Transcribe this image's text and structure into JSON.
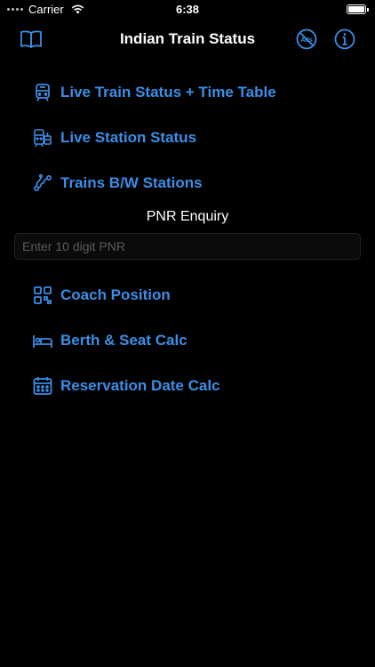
{
  "status_bar": {
    "carrier": "Carrier",
    "time": "6:38"
  },
  "nav": {
    "title": "Indian Train Status",
    "left_icon": "book-icon",
    "right_icons": [
      "no-ads-icon",
      "info-icon"
    ]
  },
  "menu_top": [
    {
      "label": "Live Train Status + Time Table",
      "icon": "train-icon"
    },
    {
      "label": "Live Station Status",
      "icon": "station-icon"
    },
    {
      "label": "Trains B/W Stations",
      "icon": "route-icon"
    }
  ],
  "pnr": {
    "title": "PNR Enquiry",
    "placeholder": "Enter 10 digit PNR",
    "value": ""
  },
  "menu_bottom": [
    {
      "label": "Coach Position",
      "icon": "grid-icon"
    },
    {
      "label": "Berth & Seat Calc",
      "icon": "bed-icon"
    },
    {
      "label": "Reservation Date Calc",
      "icon": "calendar-icon"
    }
  ],
  "colors": {
    "accent": "#3a8ee6",
    "background": "#000000",
    "text": "#ffffff"
  }
}
